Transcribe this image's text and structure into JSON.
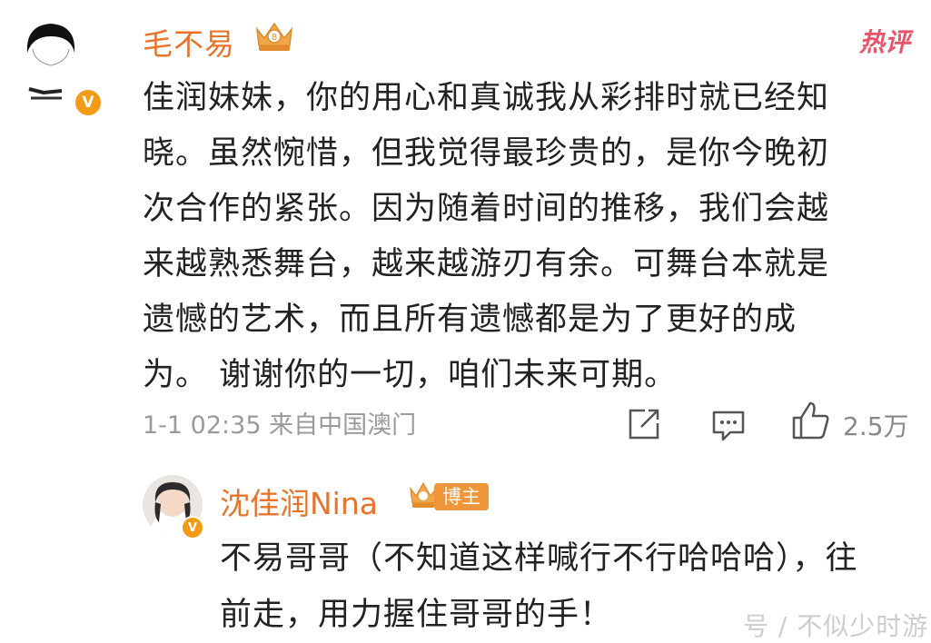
{
  "comment": {
    "username": "毛不易",
    "hot_label": "热评",
    "verified_mark": "V",
    "lines": [
      "佳润妹妹，你的用心和真诚我从彩排时就已经知",
      "晓。虽然惋惜，但我觉得最珍贵的，是你今晚初",
      "次合作的紧张。因为随着时间的推移，我们会越",
      "来越熟悉舞台，越来越游刃有余。可舞台本就是",
      "遗憾的艺术，而且所有遗憾都是为了更好的成",
      "为。 谢谢你的一切，咱们未来可期。"
    ],
    "timestamp": "1-1 02:35",
    "source": "来自中国澳门",
    "like_count": "2.5万"
  },
  "reply": {
    "username": "沈佳润Nina",
    "badge": "博主",
    "verified_mark": "V",
    "lines": [
      "不易哥哥（不知道这样喊行不行哈哈哈），往",
      "前走，用力握住哥哥的手！"
    ]
  },
  "watermark": "号 / 不似少时游",
  "icons": {
    "share": "share-icon",
    "comment": "comment-icon",
    "like": "like-icon",
    "crown": "crown-icon"
  },
  "colors": {
    "username": "#e8742c",
    "verified": "#f39b15",
    "hot": "#e9546b",
    "meta": "#9a9a9a"
  }
}
